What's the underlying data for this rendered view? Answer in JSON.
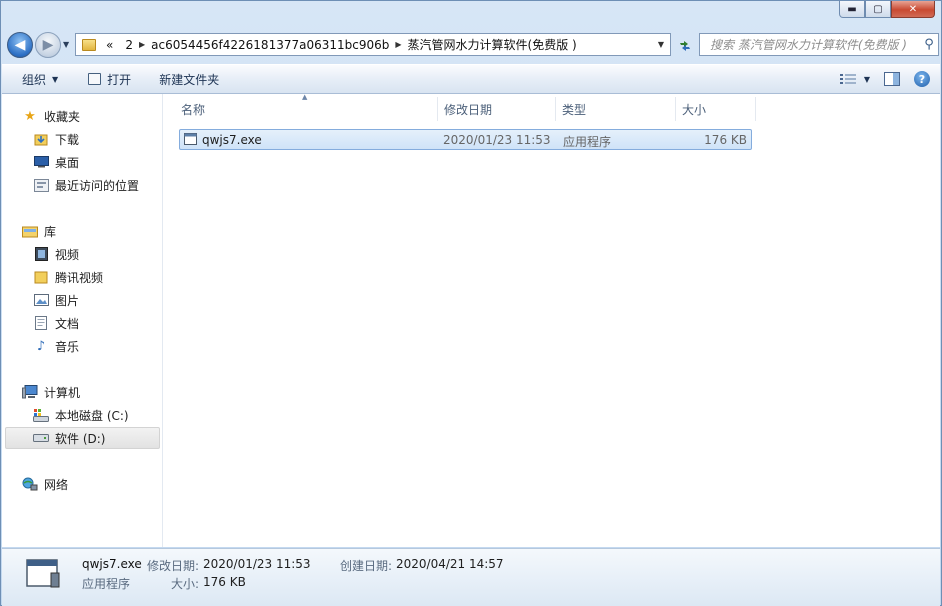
{
  "window": {
    "caption_buttons": {
      "minimize": "▬",
      "maximize": "▢",
      "close": "✕"
    }
  },
  "nav": {
    "back_glyph": "◀",
    "forward_glyph": "▶",
    "breadcrumb": [
      "«",
      "2",
      "ac6054456f4226181377a06311bc906b",
      "蒸汽管网水力计算软件(免费版 )"
    ],
    "search_placeholder": "搜索 蒸汽管网水力计算软件(免费版 )"
  },
  "toolbar": {
    "organize": "组织",
    "open": "打开",
    "new_folder": "新建文件夹"
  },
  "sidebar": {
    "favorites": "收藏夹",
    "downloads": "下载",
    "desktop": "桌面",
    "recent": "最近访问的位置",
    "library": "库",
    "video": "视频",
    "tencent_video": "腾讯视频",
    "pictures": "图片",
    "documents": "文档",
    "music": "音乐",
    "computer": "计算机",
    "local_disk": "本地磁盘 (C:)",
    "software_disk": "软件 (D:)",
    "network": "网络"
  },
  "columns": {
    "name": "名称",
    "modified": "修改日期",
    "type": "类型",
    "size": "大小"
  },
  "files": [
    {
      "name": "qwjs7.exe",
      "modified": "2020/01/23 11:53",
      "type": "应用程序",
      "size": "176 KB"
    }
  ],
  "status": {
    "filename": "qwjs7.exe",
    "modified_label": "修改日期:",
    "modified_value": "2020/01/23 11:53",
    "created_label": "创建日期:",
    "created_value": "2020/04/21 14:57",
    "type": "应用程序",
    "size_label": "大小:",
    "size_value": "176 KB"
  },
  "colors": {
    "accent": "#2c6fc4",
    "selection": "#cfe3f8"
  }
}
